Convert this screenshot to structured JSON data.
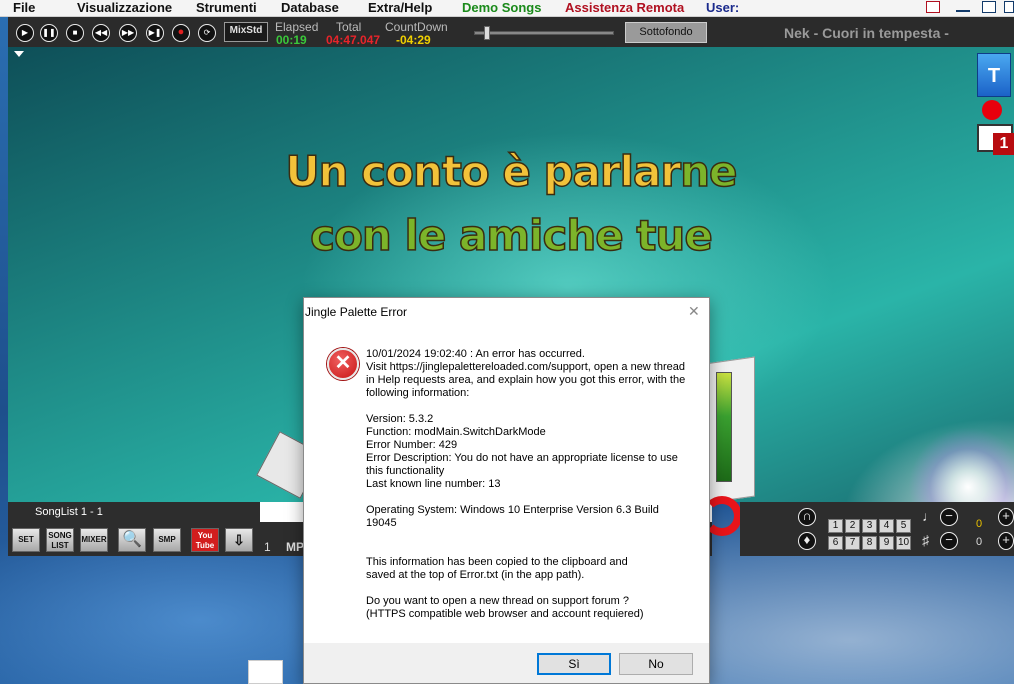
{
  "menu": {
    "items": [
      "File",
      "Visualizzazione",
      "Strumenti",
      "Database",
      "Extra/Help",
      "Demo Songs",
      "Assistenza Remota",
      "User:"
    ]
  },
  "toolbar": {
    "buttons": [
      "play",
      "pause",
      "stop",
      "rewind",
      "fast-forward",
      "next",
      "record",
      "loop"
    ],
    "mixstd_label": "MixStd",
    "elapsed_label": "Elapsed",
    "elapsed_value": "00:19",
    "total_label": "Total",
    "total_value": "04:47.047",
    "countdown_label": "CountDown",
    "countdown_value": "-04:29",
    "sottofondo_label": "Sottofondo",
    "song_title": "Nek - Cuori in tempesta -"
  },
  "lyrics": {
    "line1_sung": "Un conto è parlar",
    "line1_unsung": "ne",
    "line2": "con le amiche tue"
  },
  "side_icons": {
    "t_label": "T",
    "mail_badge": "1"
  },
  "songlist": {
    "title": "SongList 1 - 1",
    "tools": [
      "SET",
      "SONG LIST",
      "MIXER",
      "SEARCH",
      "SMP",
      "You Tube",
      "EXPORT"
    ],
    "row_number": "1",
    "row_text": "MP"
  },
  "right_panel": {
    "keys_row1": [
      "1",
      "2",
      "3",
      "4",
      "5"
    ],
    "keys_row2": [
      "6",
      "7",
      "8",
      "9",
      "10"
    ],
    "pitch_value": "0",
    "key_value": "0"
  },
  "dialog": {
    "title": "Jingle Palette Error",
    "line_timestamp": "10/01/2024 19:02:40 : An error has occurred.",
    "visit_text": "Visit https://jinglepalettereloaded.com/support, open a new thread in Help requests area, and explain how you got this error, with the following information:",
    "version": "Version: 5.3.2",
    "function": "Function: modMain.SwitchDarkMode",
    "error_number": "Error Number: 429",
    "error_description": "Error Description: You do not have an appropriate license to use this functionality",
    "last_line": "Last known line number: 13",
    "os": "Operating System: Windows 10 Enterprise Version 6.3 Build 19045",
    "clipboard_text": "This information has been copied to the clipboard and saved at the top of Error.txt (in the app path).",
    "question": "Do you want to open a new thread on support forum ?",
    "requirement": "(HTTPS compatible web browser and account requiered)",
    "yes_label": "Sì",
    "no_label": "No"
  }
}
